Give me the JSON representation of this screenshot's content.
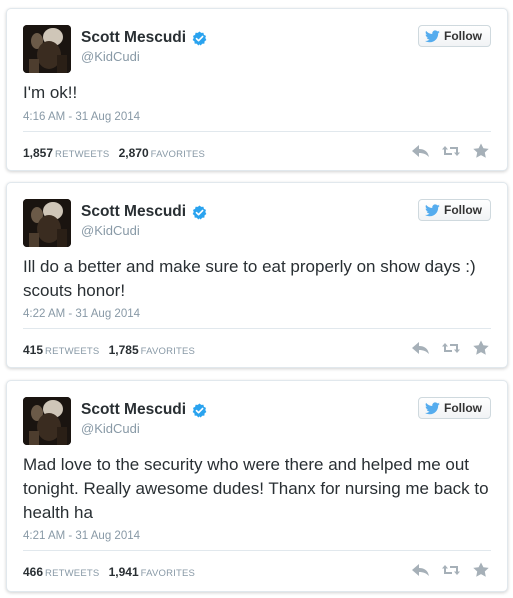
{
  "colors": {
    "verified": "#2aa3ef",
    "bird": "#55acee",
    "action_icon": "#a6b0b8",
    "meta_text": "#8899a6",
    "body_text": "#292f33"
  },
  "tweets": [
    {
      "author_name": "Scott Mescudi",
      "author_handle": "@KidCudi",
      "follow_label": "Follow",
      "text": "I'm ok!!",
      "timestamp": "4:16 AM - 31 Aug 2014",
      "retweets": "1,857",
      "retweets_label": "RETWEETS",
      "favorites": "2,870",
      "favorites_label": "FAVORITES",
      "icons": [
        "reply-icon",
        "retweet-icon",
        "favorite-icon"
      ]
    },
    {
      "author_name": "Scott Mescudi",
      "author_handle": "@KidCudi",
      "follow_label": "Follow",
      "text": "Ill do a better and make sure to eat properly on show days :) scouts honor!",
      "timestamp": "4:22 AM - 31 Aug 2014",
      "retweets": "415",
      "retweets_label": "RETWEETS",
      "favorites": "1,785",
      "favorites_label": "FAVORITES",
      "icons": [
        "reply-icon",
        "retweet-icon",
        "favorite-icon"
      ]
    },
    {
      "author_name": "Scott Mescudi",
      "author_handle": "@KidCudi",
      "follow_label": "Follow",
      "text": "Mad love to the security who were there and helped me out tonight. Really awesome dudes!  Thanx for nursing me back to health ha",
      "timestamp": "4:21 AM - 31 Aug 2014",
      "retweets": "466",
      "retweets_label": "RETWEETS",
      "favorites": "1,941",
      "favorites_label": "FAVORITES",
      "icons": [
        "reply-icon",
        "retweet-icon",
        "favorite-icon"
      ]
    }
  ]
}
